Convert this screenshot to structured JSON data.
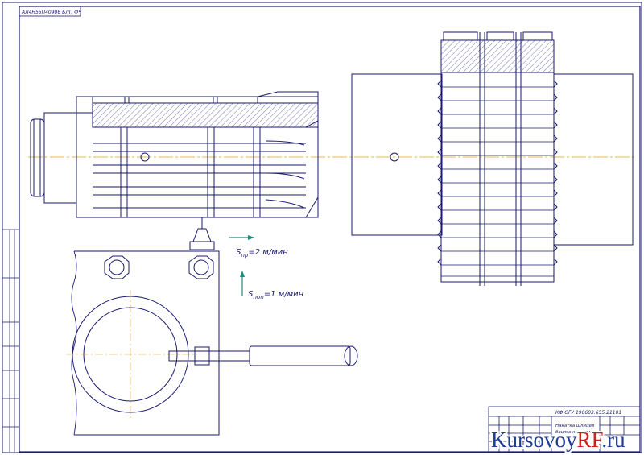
{
  "drawing": {
    "top_code": "АЛ4Н55П40906 БЛП ФЧ",
    "stamp_code": "КФ ОГУ 190603.655.21101",
    "stamp_title_line1": "Накатка шлицев",
    "stamp_title_line2": "башмачная головка"
  },
  "annotations": {
    "feed_long": {
      "symbol": "S",
      "subscript": "пр",
      "value": "=2 м/мин"
    },
    "feed_cross": {
      "symbol": "S",
      "subscript": "поп",
      "value": "=1 м/мин"
    }
  },
  "watermark": {
    "part1": "Kursovoy",
    "part2": "RF",
    "part3": ".ru"
  },
  "colors": {
    "line": "#1a1a6e",
    "accent_arrow": "#1e8c7e",
    "axis": "#e0a020",
    "watermark_blue": "#1e3c96",
    "watermark_red": "#d21e1e"
  }
}
